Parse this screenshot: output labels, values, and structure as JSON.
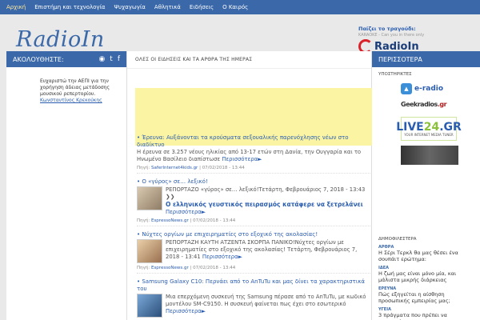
{
  "topnav": [
    "Αρχική",
    "Επιστήμη και τεχνολογία",
    "Ψυχαγωγία",
    "Αθλητικά",
    "Ειδήσεις",
    "Ο Καιρός"
  ],
  "logo": "RadioIn",
  "now_playing": {
    "label": "Παίζει το τραγούδι:",
    "track": "KARAOKE - Can you in there only",
    "brand": "RadioIn"
  },
  "left": {
    "heading": "ΑΚΟΛΟΥΘΗΣΤΕ:",
    "social_icons": [
      "rss-icon",
      "twitter-icon",
      "facebook-icon"
    ],
    "thanks": "Ευχαριστώ την ΑΕΠΙ για την χορήγηση άδειας μετάδοσης μουσικού ρεπερτορίου.",
    "author": "Κωνσταντίνος Κρεκούκης"
  },
  "main": {
    "heading": "ΟΛΕΣ ΟΙ ΕΙΔΗΣΕΙΣ ΚΑΙ ΤΑ ΑΡΘΡΑ ΤΗΣ ΗΜΕΡΑΣ",
    "news": [
      {
        "title": "Έρευνα: Αυξάνονται τα κρούσματα σεξουαλικής παρενόχλησης νέων στο διαδίκτυο",
        "text": "Η έρευνα σε 3.257 νέους ηλικίας από 13-17 ετών στη Δανία, την Ουγγαρία και το Ηνωμένο Βασίλειο διαπίστωσε",
        "more": "Περισσότερα►",
        "source": "SaferInternet4kids.gr",
        "date": "07/02/2018 - 13:44"
      },
      {
        "title": "Ο «γύρος» σε… λεξικό!",
        "text": "ΡΕΠΟΡΤΑΖΟ «γύρος» σε… λεξικό!Τετάρτη, Φεβρουάριος 7, 2018 - 13:43 ❯❯",
        "headline": "Ο ελληνικός γευστικός πειρασμός κατάφερε να ξετρελάνει",
        "more": "Περισσότερα►",
        "source": "EspressoNews.gr",
        "date": "07/02/2018 - 13:44"
      },
      {
        "title": "Νύχτες οργίων με επιχειρηματίες στο εξοχικό της ακολασίας!",
        "text": "ΡΕΠΟΡΤΑΖΗ ΚΑΥΤΗ ΑΤΖΕΝΤΑ ΣΚΟΡΠΑ ΠΑΝΙΚΟ!Νύχτες οργίων με επιχειρηματίες στο εξοχικό της ακολασίας! Τετάρτη, Φεβρουάριος 7, 2018 - 13:41",
        "more": "Περισσότερα►",
        "source": "EspressoNews.gr",
        "date": "07/02/2018 - 13:44"
      },
      {
        "title": "Samsung Galaxy C10: Περνάει από το AnTuTu και μας δίνει τα χαρακτηριστικά του",
        "text": "Μια επερχόμενη συσκευή της Samsung πέρασε από το AnTuTu, με κωδικό μοντέλου SM-C9150. Η συσκευή φαίνεται πως έχει στο εσωτερικό",
        "more": "Περισσότερα►"
      }
    ]
  },
  "right": {
    "heading": "ΠΕΡΙΣΣΟΤΕΡΑ",
    "sponsors_label": "ΥΠΟΣΤΗΡΙΚΤΕΣ",
    "eradio": "e-radio",
    "geek": "Geekradios",
    "geek_gr": ".gr",
    "live": "LIVE",
    "live_24": "24",
    "live_gr": ".GR",
    "live_tag": "YOUR INTERNET MEDIA TUNER",
    "latest_label": "ΔΗΜΟΦΙΛΕΣΤΕΡΑ",
    "latest": [
      {
        "cat": "ΑΡΘΡΑ",
        "title": "Η Σέρι Τερκλ θα μας θέσει ένα σουπάιτ ερώτημα:"
      },
      {
        "cat": "ΙΔΕΑ",
        "title": "Η ζωή μας είναι μόνο μία, και μάλιστα μικρής διάρκειας"
      },
      {
        "cat": "ΕΡΕΥΝΑ",
        "title": "Πώς εξηγείται η αίσθηση προσωπικής εμπειρίας μας;"
      },
      {
        "cat": "ΥΓΕΙΑ",
        "title": "3 πράγματα που πρέπει να σταματήσετε"
      }
    ]
  },
  "colors": {
    "nav": "#3a68a8",
    "ad": "#fbf5a3",
    "link": "#2a5db0"
  }
}
